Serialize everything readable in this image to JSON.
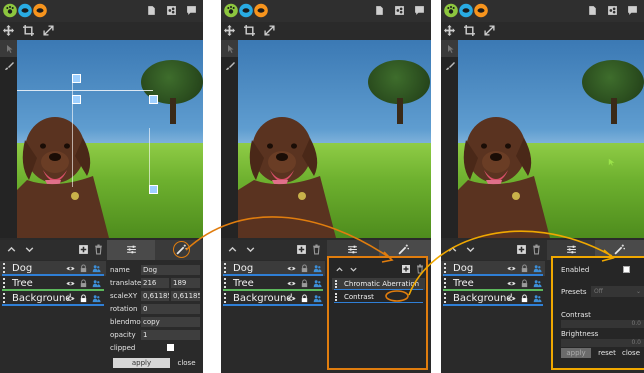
{
  "colors": {
    "accent_orange": "#e07d0e",
    "accent_amber": "#f0a800",
    "layer_underline": "#2f7fd6",
    "layer_underline_green": "#5cb85c",
    "panel_bg": "#2a2a2a"
  },
  "icons": {
    "logo": "app-logo-icon",
    "top": [
      "page-icon",
      "share-icon",
      "chat-icon"
    ],
    "tools": [
      "move-icon",
      "crop-icon",
      "expand-icon"
    ],
    "left": [
      "pointer-icon",
      "brush-icon"
    ]
  },
  "panel1": {
    "layers": [
      {
        "name": "Dog"
      },
      {
        "name": "Tree"
      },
      {
        "name": "Background"
      }
    ],
    "properties": {
      "name_label": "name",
      "name_value": "Dog",
      "translate_label": "translateX",
      "translate_x": "216",
      "translate_y": "189",
      "scale_label": "scaleXY",
      "scale_x": "0,611858",
      "scale_y": "0,611858",
      "rotation_label": "rotation",
      "rotation_value": "0",
      "blend_label": "blendmod",
      "blend_value": "copy",
      "opacity_label": "opacity",
      "opacity_value": "1",
      "clipped_label": "clipped",
      "apply_label": "apply",
      "close_label": "close"
    }
  },
  "panel2": {
    "layers": [
      {
        "name": "Dog"
      },
      {
        "name": "Tree"
      },
      {
        "name": "Background"
      }
    ],
    "effects": [
      {
        "name": "Chromatic Aberration"
      },
      {
        "name": "Contrast"
      }
    ]
  },
  "panel3": {
    "layers": [
      {
        "name": "Dog"
      },
      {
        "name": "Tree"
      },
      {
        "name": "Background"
      }
    ],
    "effect_settings": {
      "enabled_label": "Enabled",
      "presets_label": "Presets",
      "presets_value": "Off",
      "contrast_label": "Contrast",
      "contrast_value": "0.0",
      "brightness_label": "Brightness",
      "brightness_value": "0.0",
      "apply_label": "apply",
      "reset_label": "reset",
      "close_label": "close"
    }
  }
}
